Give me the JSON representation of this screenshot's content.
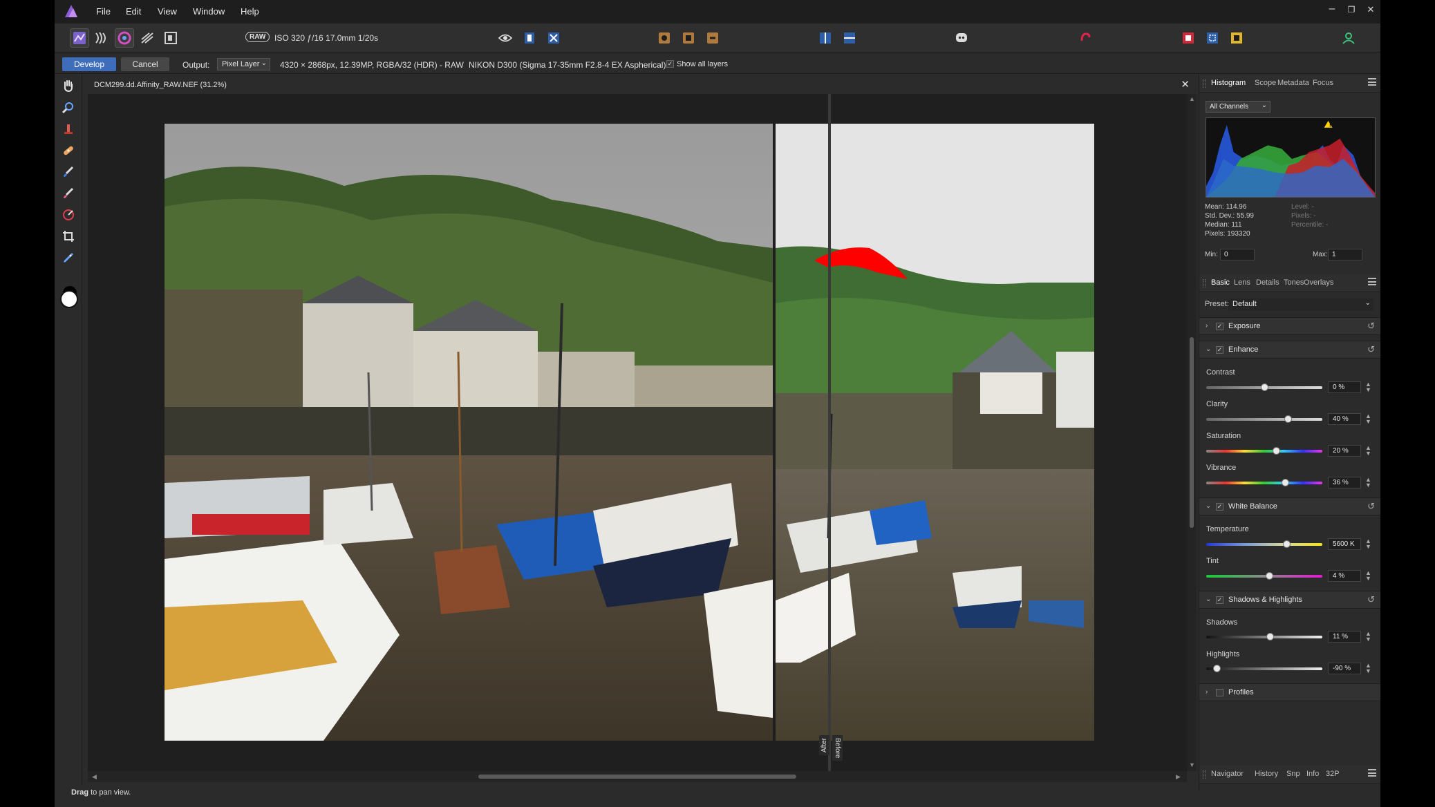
{
  "menu": {
    "items": [
      "File",
      "Edit",
      "View",
      "Window",
      "Help"
    ],
    "window_controls": [
      "–",
      "❐",
      "✕"
    ]
  },
  "toolbar": {
    "raw_badge": "RAW",
    "exif": "ISO 320 ƒ/16 17.0mm 1/20s"
  },
  "context": {
    "develop": "Develop",
    "cancel": "Cancel",
    "output_label": "Output:",
    "output_value": "Pixel Layer",
    "image_info": "4320 × 2868px, 12.39MP, RGBA/32 (HDR) - RAW",
    "camera": "NIKON D300 (Sigma 17-35mm F2.8-4 EX Aspherical)",
    "show_layers": "Show all layers",
    "show_layers_checked": "✓"
  },
  "document": {
    "title": "DCM299.dd.Affinity_RAW.NEF (31.2%)",
    "close": "✕",
    "after_label": "After",
    "before_label": "Before"
  },
  "status": {
    "bold": "Drag",
    "text": " to pan view."
  },
  "histogram_panel": {
    "tabs": [
      "Histogram",
      "Scope",
      "Metadata",
      "Focus"
    ],
    "channel": "All Channels",
    "stats_left": [
      "Mean: 114.96",
      "Std. Dev.: 55.99",
      "Median: 111",
      "Pixels: 193320"
    ],
    "stats_right": [
      "Level: -",
      "Pixels: -",
      "Percentile: -"
    ],
    "min_label": "Min:",
    "min_value": "0",
    "max_label": "Max:",
    "max_value": "1",
    "warning": "!"
  },
  "develop_panel": {
    "tabs": [
      "Basic",
      "Lens",
      "Details",
      "Tones",
      "Overlays"
    ],
    "preset_label": "Preset:",
    "preset_value": "Default",
    "sections": {
      "exposure": "Exposure",
      "enhance": "Enhance",
      "white_balance": "White Balance",
      "shadows_highlights": "Shadows & Highlights",
      "profiles": "Profiles"
    },
    "checkmark": "✓",
    "sliders": {
      "contrast": {
        "label": "Contrast",
        "value": "0 %",
        "level": 0.5
      },
      "clarity": {
        "label": "Clarity",
        "value": "40 %",
        "level": 0.7
      },
      "saturation": {
        "label": "Saturation",
        "value": "20 %",
        "level": 0.6
      },
      "vibrance": {
        "label": "Vibrance",
        "value": "36 %",
        "level": 0.68
      },
      "temperature": {
        "label": "Temperature",
        "value": "5600 K",
        "level": 0.69
      },
      "tint": {
        "label": "Tint",
        "value": "4 %",
        "level": 0.54
      },
      "shadows": {
        "label": "Shadows",
        "value": "11 %",
        "level": 0.55
      },
      "highlights": {
        "label": "Highlights",
        "value": "-90 %",
        "level": 0.09
      }
    }
  },
  "bottom_panel": {
    "tabs": [
      "Navigator",
      "History",
      "Snp",
      "Info",
      "32P"
    ]
  },
  "colors": {
    "accent": "#3d6dbb",
    "clip_warning": "#ff0000",
    "user_icon": "#3cc47c"
  }
}
